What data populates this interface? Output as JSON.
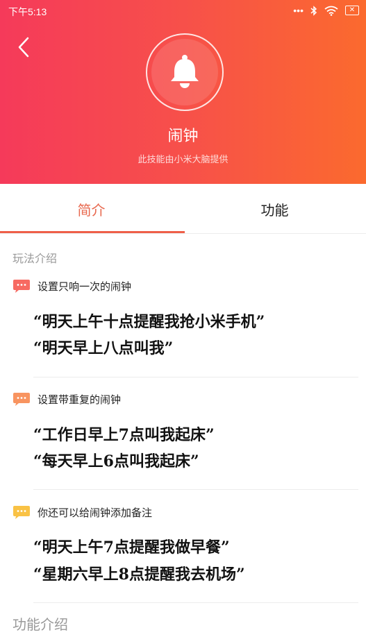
{
  "status": {
    "time": "下午5:13",
    "dots": "•••",
    "battery": "✕"
  },
  "header": {
    "title": "闹钟",
    "subtitle": "此技能由小米大脑提供"
  },
  "tabs": [
    {
      "label": "简介"
    },
    {
      "label": "功能"
    }
  ],
  "sections": {
    "play": "玩法介绍",
    "features": "功能介绍"
  },
  "groups": [
    {
      "title": "设置只响一次的闹钟",
      "bubble_color": "#f76a62",
      "quotes": [
        "“明天上午十点提醒我抢小米手机”",
        "“明天早上八点叫我”"
      ]
    },
    {
      "title": "设置带重复的闹钟",
      "bubble_color": "#f89460",
      "quotes": [
        "“工作日早上7点叫我起床”",
        "“每天早上6点叫我起床”"
      ]
    },
    {
      "title": "你还可以给闹钟添加备注",
      "bubble_color": "#f9c245",
      "quotes": [
        "“明天上午7点提醒我做早餐”",
        "“星期六早上8点提醒我去机场”"
      ]
    }
  ]
}
